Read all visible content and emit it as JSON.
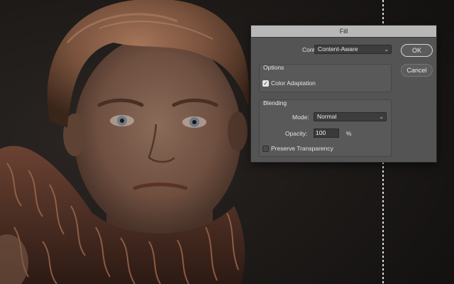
{
  "dialog": {
    "title": "Fill",
    "contents_label": "Contents:",
    "contents_value": "Content-Aware",
    "ok_label": "OK",
    "cancel_label": "Cancel",
    "options_title": "Options",
    "color_adaptation_label": "Color Adaptation",
    "color_adaptation_checked": true,
    "blending_title": "Blending",
    "mode_label": "Mode:",
    "mode_value": "Normal",
    "opacity_label": "Opacity:",
    "opacity_value": "100",
    "opacity_unit": "%",
    "preserve_transparency_label": "Preserve Transparency",
    "preserve_transparency_checked": false
  },
  "icons": {
    "dropdown": "chevron-down-icon",
    "check": "checkmark-icon"
  },
  "colors": {
    "dialog_bg": "#545454",
    "titlebar_bg": "#b8b8b8",
    "photo_bg": "#1a1817"
  }
}
